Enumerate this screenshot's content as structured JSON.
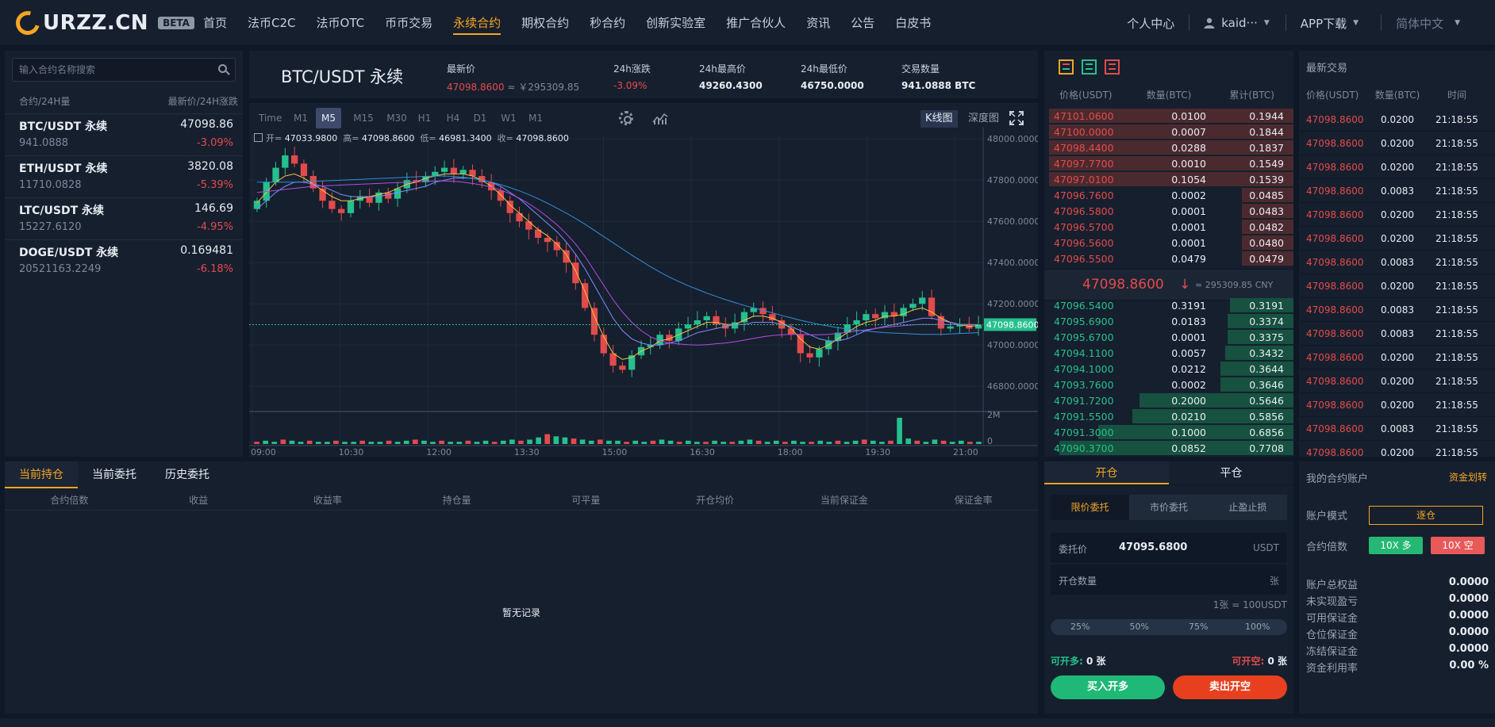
{
  "brand": {
    "name": "URZZ.CN",
    "badge": "BETA"
  },
  "nav": [
    "首页",
    "法币C2C",
    "法币OTC",
    "币币交易",
    "永续合约",
    "期权合约",
    "秒合约",
    "创新实验室",
    "推广合伙人",
    "资讯",
    "公告",
    "白皮书"
  ],
  "nav_active": "永续合约",
  "topright": {
    "center": "个人中心",
    "user": "kaid···",
    "app": "APP下载",
    "lang": "简体中文"
  },
  "market": {
    "search_placeholder": "输入合约名称搜索",
    "head_left": "合约/24H量",
    "head_right": "最新价/24H涨跌",
    "rows": [
      {
        "symbol": "BTC/USDT 永续",
        "price": "47098.86",
        "volume": "941.0888",
        "change": "-3.09%"
      },
      {
        "symbol": "ETH/USDT 永续",
        "price": "3820.08",
        "volume": "11710.0828",
        "change": "-5.39%"
      },
      {
        "symbol": "LTC/USDT 永续",
        "price": "146.69",
        "volume": "15227.6120",
        "change": "-4.95%"
      },
      {
        "symbol": "DOGE/USDT 永续",
        "price": "0.169481",
        "volume": "20521163.2249",
        "change": "-6.18%"
      }
    ]
  },
  "ticker": {
    "pair": "BTC/USDT 永续",
    "last_label": "最新价",
    "last_price": "47098.8600",
    "last_cny": "≈ ￥295309.85",
    "change_label": "24h涨跌",
    "change": "-3.09%",
    "high_label": "24h最高价",
    "high": "49260.4300",
    "low_label": "24h最低价",
    "low": "46750.0000",
    "vol_label": "交易数量",
    "vol": "941.0888 BTC"
  },
  "chart": {
    "timeframes": [
      "Time",
      "M1",
      "M5",
      "M15",
      "M30",
      "H1",
      "H4",
      "D1",
      "W1",
      "M1"
    ],
    "active_tf": "M5",
    "kline_label": "K线图",
    "depth_label": "深度图",
    "ohlc": {
      "open_label": "开=",
      "open": "47033.9800",
      "high_label": "高=",
      "high": "47098.8600",
      "low_label": "低=",
      "low": "46981.3400",
      "close_label": "收=",
      "close": "47098.8600"
    },
    "current_price_tag": "47098.8600",
    "volume_tick": "2M",
    "volume_zero": "0"
  },
  "chart_data": {
    "type": "line",
    "x_ticks": [
      "09:00",
      "10:30",
      "12:00",
      "13:30",
      "15:00",
      "16:30",
      "18:00",
      "19:30",
      "21:00"
    ],
    "y_ticks": [
      "48000.0000",
      "47800.0000",
      "47600.0000",
      "47400.0000",
      "47200.0000",
      "47000.0000",
      "46800.0000"
    ],
    "ylim": [
      46720,
      48020
    ],
    "candle_close_series": [
      47700,
      47790,
      47860,
      47920,
      47880,
      47820,
      47760,
      47700,
      47660,
      47640,
      47700,
      47720,
      47690,
      47740,
      47710,
      47760,
      47800,
      47790,
      47820,
      47840,
      47860,
      47830,
      47850,
      47820,
      47790,
      47750,
      47700,
      47640,
      47600,
      47560,
      47520,
      47500,
      47460,
      47400,
      47300,
      47180,
      47050,
      46960,
      46900,
      46880,
      46950,
      46990,
      47000,
      47050,
      47020,
      47080,
      47100,
      47120,
      47140,
      47100,
      47080,
      47110,
      47160,
      47180,
      47150,
      47120,
      47080,
      47050,
      46960,
      46940,
      46980,
      47020,
      47060,
      47100,
      47120,
      47150,
      47130,
      47160,
      47140,
      47180,
      47200,
      47230,
      47140,
      47080,
      47090,
      47100,
      47080,
      47098
    ],
    "ma_series": [
      {
        "color": "#f5c242",
        "values": [
          47690,
          47740,
          47790,
          47820,
          47830,
          47810,
          47780,
          47750,
          47720,
          47700,
          47700,
          47710,
          47720,
          47730,
          47740,
          47760,
          47780,
          47790,
          47810,
          47820,
          47830,
          47830,
          47830,
          47820,
          47800,
          47770,
          47730,
          47680,
          47640,
          47600,
          47560,
          47530,
          47490,
          47440,
          47360,
          47260,
          47140,
          47040,
          46960,
          46930,
          46940,
          46970,
          46990,
          47020,
          47030,
          47050,
          47070,
          47090,
          47110,
          47110,
          47100,
          47100,
          47120,
          47140,
          47140,
          47130,
          47110,
          47080,
          47030,
          46990,
          46980,
          47000,
          47030,
          47060,
          47090,
          47110,
          47120,
          47140,
          47140,
          47150,
          47170,
          47180,
          47160,
          47130,
          47110,
          47100,
          47090,
          47095
        ]
      },
      {
        "color": "#7f8cff",
        "values": [
          47660,
          47700,
          47740,
          47770,
          47790,
          47790,
          47780,
          47770,
          47750,
          47730,
          47720,
          47720,
          47720,
          47720,
          47730,
          47740,
          47750,
          47760,
          47770,
          47790,
          47800,
          47810,
          47810,
          47810,
          47800,
          47790,
          47770,
          47740,
          47710,
          47670,
          47630,
          47590,
          47550,
          47500,
          47440,
          47370,
          47290,
          47210,
          47130,
          47070,
          47030,
          47010,
          47000,
          47000,
          47010,
          47020,
          47040,
          47060,
          47070,
          47080,
          47090,
          47100,
          47100,
          47110,
          47110,
          47110,
          47100,
          47090,
          47070,
          47050,
          47030,
          47020,
          47020,
          47030,
          47050,
          47070,
          47080,
          47090,
          47100,
          47110,
          47120,
          47130,
          47130,
          47120,
          47110,
          47100,
          47100,
          47098
        ]
      },
      {
        "color": "#b04ee0",
        "values": [
          47740,
          47745,
          47750,
          47755,
          47760,
          47765,
          47770,
          47772,
          47774,
          47776,
          47778,
          47780,
          47782,
          47784,
          47786,
          47788,
          47790,
          47792,
          47794,
          47796,
          47796,
          47794,
          47790,
          47784,
          47776,
          47766,
          47752,
          47734,
          47712,
          47686,
          47656,
          47622,
          47584,
          47540,
          47490,
          47430,
          47360,
          47290,
          47220,
          47160,
          47110,
          47070,
          47040,
          47020,
          47010,
          47005,
          47002,
          47000,
          47002,
          47006,
          47010,
          47016,
          47024,
          47032,
          47040,
          47046,
          47050,
          47052,
          47052,
          47050,
          47050,
          47052,
          47056,
          47062,
          47068,
          47074,
          47080,
          47086,
          47090,
          47094,
          47098,
          47100,
          47100,
          47100,
          47100,
          47100,
          47100,
          47100
        ]
      },
      {
        "color": "#2f8fd8",
        "values": [
          47790,
          47790,
          47790,
          47790,
          47790,
          47792,
          47794,
          47796,
          47798,
          47800,
          47802,
          47804,
          47806,
          47808,
          47810,
          47812,
          47814,
          47816,
          47818,
          47820,
          47820,
          47818,
          47814,
          47808,
          47800,
          47790,
          47778,
          47764,
          47748,
          47730,
          47710,
          47688,
          47664,
          47640,
          47614,
          47586,
          47556,
          47526,
          47496,
          47466,
          47436,
          47408,
          47380,
          47354,
          47330,
          47308,
          47288,
          47270,
          47252,
          47236,
          47220,
          47206,
          47192,
          47180,
          47168,
          47156,
          47144,
          47132,
          47120,
          47110,
          47100,
          47092,
          47084,
          47078,
          47072,
          47068,
          47064,
          47060,
          47058,
          47056,
          47054,
          47052,
          47052,
          47052,
          47054,
          47056,
          47058,
          47060
        ]
      }
    ],
    "volume_series": [
      2,
      3,
      2,
      4,
      3,
      2,
      3,
      2,
      2,
      3,
      2,
      2,
      3,
      2,
      2,
      3,
      2,
      3,
      4,
      3,
      2,
      3,
      2,
      2,
      3,
      2,
      3,
      2,
      3,
      4,
      3,
      4,
      6,
      9,
      7,
      6,
      5,
      4,
      3,
      4,
      3,
      3,
      2,
      3,
      2,
      3,
      4,
      3,
      2,
      3,
      2,
      2,
      3,
      2,
      2,
      3,
      4,
      3,
      2,
      3,
      2,
      3,
      2,
      2,
      3,
      2,
      3,
      2,
      3,
      4,
      3,
      2,
      3,
      24,
      5,
      3,
      2,
      4,
      3,
      2,
      3,
      2,
      2
    ]
  },
  "book": {
    "head": [
      "价格(USDT)",
      "数量(BTC)",
      "累计(BTC)"
    ],
    "asks": [
      {
        "p": "47101.0600",
        "q": "0.0100",
        "t": "0.1944",
        "d": 1.0
      },
      {
        "p": "47100.0000",
        "q": "0.0007",
        "t": "0.1844",
        "d": 1.0
      },
      {
        "p": "47098.4400",
        "q": "0.0288",
        "t": "0.1837",
        "d": 1.0
      },
      {
        "p": "47097.7700",
        "q": "0.0010",
        "t": "0.1549",
        "d": 1.0
      },
      {
        "p": "47097.0100",
        "q": "0.1054",
        "t": "0.1539",
        "d": 1.0
      },
      {
        "p": "47096.7600",
        "q": "0.0002",
        "t": "0.0485",
        "d": 0.21
      },
      {
        "p": "47096.5800",
        "q": "0.0001",
        "t": "0.0483",
        "d": 0.21
      },
      {
        "p": "47096.5700",
        "q": "0.0001",
        "t": "0.0482",
        "d": 0.21
      },
      {
        "p": "47096.5600",
        "q": "0.0001",
        "t": "0.0480",
        "d": 0.21
      },
      {
        "p": "47096.5500",
        "q": "0.0479",
        "t": "0.0479",
        "d": 0.21
      }
    ],
    "mid_price": "47098.8600",
    "mid_arrow": "↓",
    "mid_cny": "≈ 295309.85 CNY",
    "bids": [
      {
        "p": "47096.5400",
        "q": "0.3191",
        "t": "0.3191",
        "d": 0.26
      },
      {
        "p": "47095.6900",
        "q": "0.0183",
        "t": "0.3374",
        "d": 0.27
      },
      {
        "p": "47095.6700",
        "q": "0.0001",
        "t": "0.3375",
        "d": 0.27
      },
      {
        "p": "47094.1100",
        "q": "0.0057",
        "t": "0.3432",
        "d": 0.28
      },
      {
        "p": "47094.1000",
        "q": "0.0212",
        "t": "0.3644",
        "d": 0.3
      },
      {
        "p": "47093.7600",
        "q": "0.0002",
        "t": "0.3646",
        "d": 0.3
      },
      {
        "p": "47091.7200",
        "q": "0.2000",
        "t": "0.5646",
        "d": 0.63
      },
      {
        "p": "47091.5500",
        "q": "0.0210",
        "t": "0.5856",
        "d": 0.66
      },
      {
        "p": "47091.3000",
        "q": "0.1000",
        "t": "0.6856",
        "d": 0.8
      },
      {
        "p": "47090.3700",
        "q": "0.0852",
        "t": "0.7708",
        "d": 0.96
      }
    ]
  },
  "trades": {
    "title": "最新交易",
    "head": [
      "价格(USDT)",
      "数量(BTC)",
      "时间"
    ],
    "rows": [
      {
        "p": "47098.8600",
        "q": "0.0200",
        "t": "21:18:55"
      },
      {
        "p": "47098.8600",
        "q": "0.0200",
        "t": "21:18:55"
      },
      {
        "p": "47098.8600",
        "q": "0.0200",
        "t": "21:18:55"
      },
      {
        "p": "47098.8600",
        "q": "0.0083",
        "t": "21:18:55"
      },
      {
        "p": "47098.8600",
        "q": "0.0200",
        "t": "21:18:55"
      },
      {
        "p": "47098.8600",
        "q": "0.0200",
        "t": "21:18:55"
      },
      {
        "p": "47098.8600",
        "q": "0.0083",
        "t": "21:18:55"
      },
      {
        "p": "47098.8600",
        "q": "0.0200",
        "t": "21:18:55"
      },
      {
        "p": "47098.8600",
        "q": "0.0083",
        "t": "21:18:55"
      },
      {
        "p": "47098.8600",
        "q": "0.0083",
        "t": "21:18:55"
      },
      {
        "p": "47098.8600",
        "q": "0.0200",
        "t": "21:18:55"
      },
      {
        "p": "47098.8600",
        "q": "0.0200",
        "t": "21:18:55"
      },
      {
        "p": "47098.8600",
        "q": "0.0200",
        "t": "21:18:55"
      },
      {
        "p": "47098.8600",
        "q": "0.0083",
        "t": "21:18:55"
      },
      {
        "p": "47098.8600",
        "q": "0.0200",
        "t": "21:18:55"
      }
    ]
  },
  "positions": {
    "tabs": [
      "当前持仓",
      "当前委托",
      "历史委托"
    ],
    "head": [
      "合约倍数",
      "收益",
      "收益率",
      "持仓量",
      "可平量",
      "开仓均价",
      "当前保证金",
      "保证金率"
    ],
    "empty": "暂无记录"
  },
  "order": {
    "tabs": [
      "开仓",
      "平仓"
    ],
    "types": [
      "限价委托",
      "市价委托",
      "止盈止损"
    ],
    "price_label": "委托价",
    "price_value": "47095.6800",
    "price_unit": "USDT",
    "qty_label": "开仓数量",
    "qty_placeholder": "",
    "qty_unit": "张",
    "hint": "1张 = 100USDT",
    "pcts": [
      "25%",
      "50%",
      "75%",
      "100%"
    ],
    "avail_long_label": "可开多:",
    "avail_long": "0 张",
    "avail_short_label": "可开空:",
    "avail_short": "0 张",
    "buy_label": "买入开多",
    "sell_label": "卖出开空"
  },
  "account": {
    "title": "我的合约账户",
    "transfer": "资金划转",
    "mode_label": "账户模式",
    "mode": "逐仓",
    "lev_label": "合约倍数",
    "lev_long": "10X 多",
    "lev_short": "10X 空",
    "rows": [
      {
        "k": "账户总权益",
        "v": "0.0000"
      },
      {
        "k": "未实现盈亏",
        "v": "0.0000"
      },
      {
        "k": "可用保证金",
        "v": "0.0000"
      },
      {
        "k": "仓位保证金",
        "v": "0.0000"
      },
      {
        "k": "冻结保证金",
        "v": "0.0000"
      },
      {
        "k": "资金利用率",
        "v": "0.00 %"
      }
    ]
  },
  "colors": {
    "up": "#25c08d",
    "down": "#e24b4b",
    "accent": "#f5a623"
  }
}
